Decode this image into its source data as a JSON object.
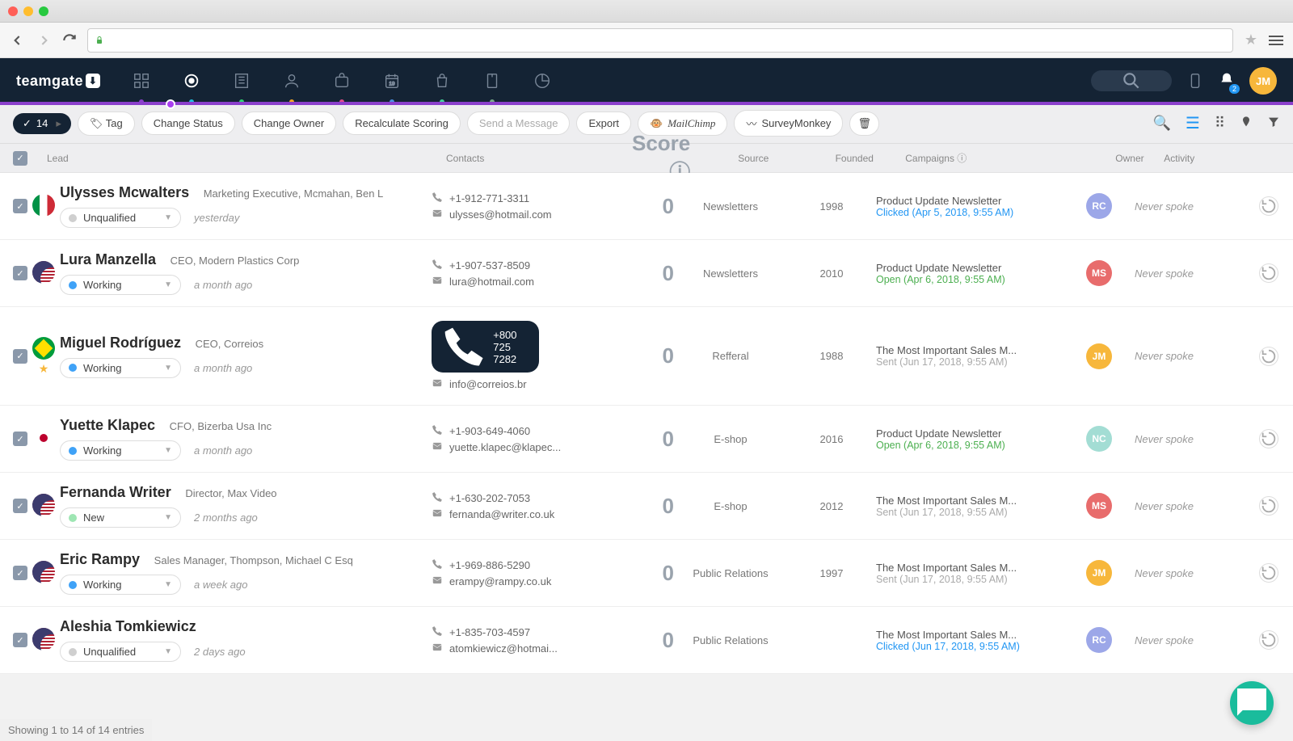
{
  "brand": "teamgate",
  "notif_count": "2",
  "user_avatar": {
    "initials": "JM",
    "color": "#f7b73b"
  },
  "selection_count": "14",
  "actions": {
    "tag": "Tag",
    "change_status": "Change Status",
    "change_owner": "Change Owner",
    "recalc": "Recalculate Scoring",
    "send": "Send a Message",
    "export": "Export",
    "mailchimp": "MailChimp",
    "surveymonkey": "SurveyMonkey"
  },
  "columns": {
    "lead": "Lead",
    "contacts": "Contacts",
    "score": "Score",
    "source": "Source",
    "founded": "Founded",
    "campaigns": "Campaigns",
    "owner": "Owner",
    "activity": "Activity"
  },
  "nav_dots": [
    "#8b3fcc",
    "#1fbfe0",
    "#2dd672",
    "#f5a623",
    "#e24a8b",
    "#4a90e2",
    "#43d19a",
    "#9aa"
  ],
  "leads": [
    {
      "flag": "it",
      "name": "Ulysses Mcwalters",
      "title": "Marketing Executive, Mcmahan, Ben L",
      "status": "Unqualified",
      "status_color": "#cfcfcf",
      "time": "yesterday",
      "phone": "+1-912-771-3311",
      "email": "ulysses@hotmail.com",
      "score": "0",
      "source": "Newsletters",
      "founded": "1998",
      "campaign": "Product Update Newsletter",
      "camp_status": "Clicked (Apr 5, 2018, 9:55 AM)",
      "camp_class": "click",
      "owner": {
        "initials": "RC",
        "color": "#9ca7e8"
      },
      "activity": "Never spoke",
      "star": false,
      "highlight": false
    },
    {
      "flag": "us",
      "name": "Lura Manzella",
      "title": "CEO, Modern Plastics Corp",
      "status": "Working",
      "status_color": "#3fa2f7",
      "time": "a month ago",
      "phone": "+1-907-537-8509",
      "email": "lura@hotmail.com",
      "score": "0",
      "source": "Newsletters",
      "founded": "2010",
      "campaign": "Product Update Newsletter",
      "camp_status": "Open (Apr 6, 2018, 9:55 AM)",
      "camp_class": "open",
      "owner": {
        "initials": "MS",
        "color": "#e86c6c"
      },
      "activity": "Never spoke",
      "star": false,
      "highlight": false
    },
    {
      "flag": "br",
      "name": "Miguel Rodríguez",
      "title": "CEO, Correios",
      "status": "Working",
      "status_color": "#3fa2f7",
      "time": "a month ago",
      "phone": "+800 725 7282",
      "email": "info@correios.br",
      "score": "0",
      "source": "Refferal",
      "founded": "1988",
      "campaign": "The Most Important Sales M...",
      "camp_status": "Sent (Jun 17, 2018, 9:55 AM)",
      "camp_class": "sent",
      "owner": {
        "initials": "JM",
        "color": "#f7b73b"
      },
      "activity": "Never spoke",
      "star": true,
      "highlight": true
    },
    {
      "flag": "jp",
      "name": "Yuette Klapec",
      "title": "CFO, Bizerba Usa Inc",
      "status": "Working",
      "status_color": "#3fa2f7",
      "time": "a month ago",
      "phone": "+1-903-649-4060",
      "email": "yuette.klapec@klapec...",
      "score": "0",
      "source": "E-shop",
      "founded": "2016",
      "campaign": "Product Update Newsletter",
      "camp_status": "Open (Apr 6, 2018, 9:55 AM)",
      "camp_class": "open",
      "owner": {
        "initials": "NC",
        "color": "#a3ddd4"
      },
      "activity": "Never spoke",
      "star": false,
      "highlight": false
    },
    {
      "flag": "us",
      "name": "Fernanda Writer",
      "title": "Director, Max Video",
      "status": "New",
      "status_color": "#9ee6b3",
      "time": "2 months ago",
      "phone": "+1-630-202-7053",
      "email": "fernanda@writer.co.uk",
      "score": "0",
      "source": "E-shop",
      "founded": "2012",
      "campaign": "The Most Important Sales M...",
      "camp_status": "Sent (Jun 17, 2018, 9:55 AM)",
      "camp_class": "sent",
      "owner": {
        "initials": "MS",
        "color": "#e86c6c"
      },
      "activity": "Never spoke",
      "star": false,
      "highlight": false
    },
    {
      "flag": "us",
      "name": "Eric Rampy",
      "title": "Sales Manager, Thompson, Michael C Esq",
      "status": "Working",
      "status_color": "#3fa2f7",
      "time": "a week ago",
      "phone": "+1-969-886-5290",
      "email": "erampy@rampy.co.uk",
      "score": "0",
      "source": "Public Relations",
      "founded": "1997",
      "campaign": "The Most Important Sales M...",
      "camp_status": "Sent (Jun 17, 2018, 9:55 AM)",
      "camp_class": "sent",
      "owner": {
        "initials": "JM",
        "color": "#f7b73b"
      },
      "activity": "Never spoke",
      "star": false,
      "highlight": false
    },
    {
      "flag": "us",
      "name": "Aleshia Tomkiewicz",
      "title": "",
      "status": "Unqualified",
      "status_color": "#cfcfcf",
      "time": "2 days ago",
      "phone": "+1-835-703-4597",
      "email": "atomkiewicz@hotmai...",
      "score": "0",
      "source": "Public Relations",
      "founded": "",
      "campaign": "The Most Important Sales M...",
      "camp_status": "Clicked (Jun 17, 2018, 9:55 AM)",
      "camp_class": "click",
      "owner": {
        "initials": "RC",
        "color": "#9ca7e8"
      },
      "activity": "Never spoke",
      "star": false,
      "highlight": false
    }
  ],
  "footer": "Showing 1 to 14 of 14 entries"
}
